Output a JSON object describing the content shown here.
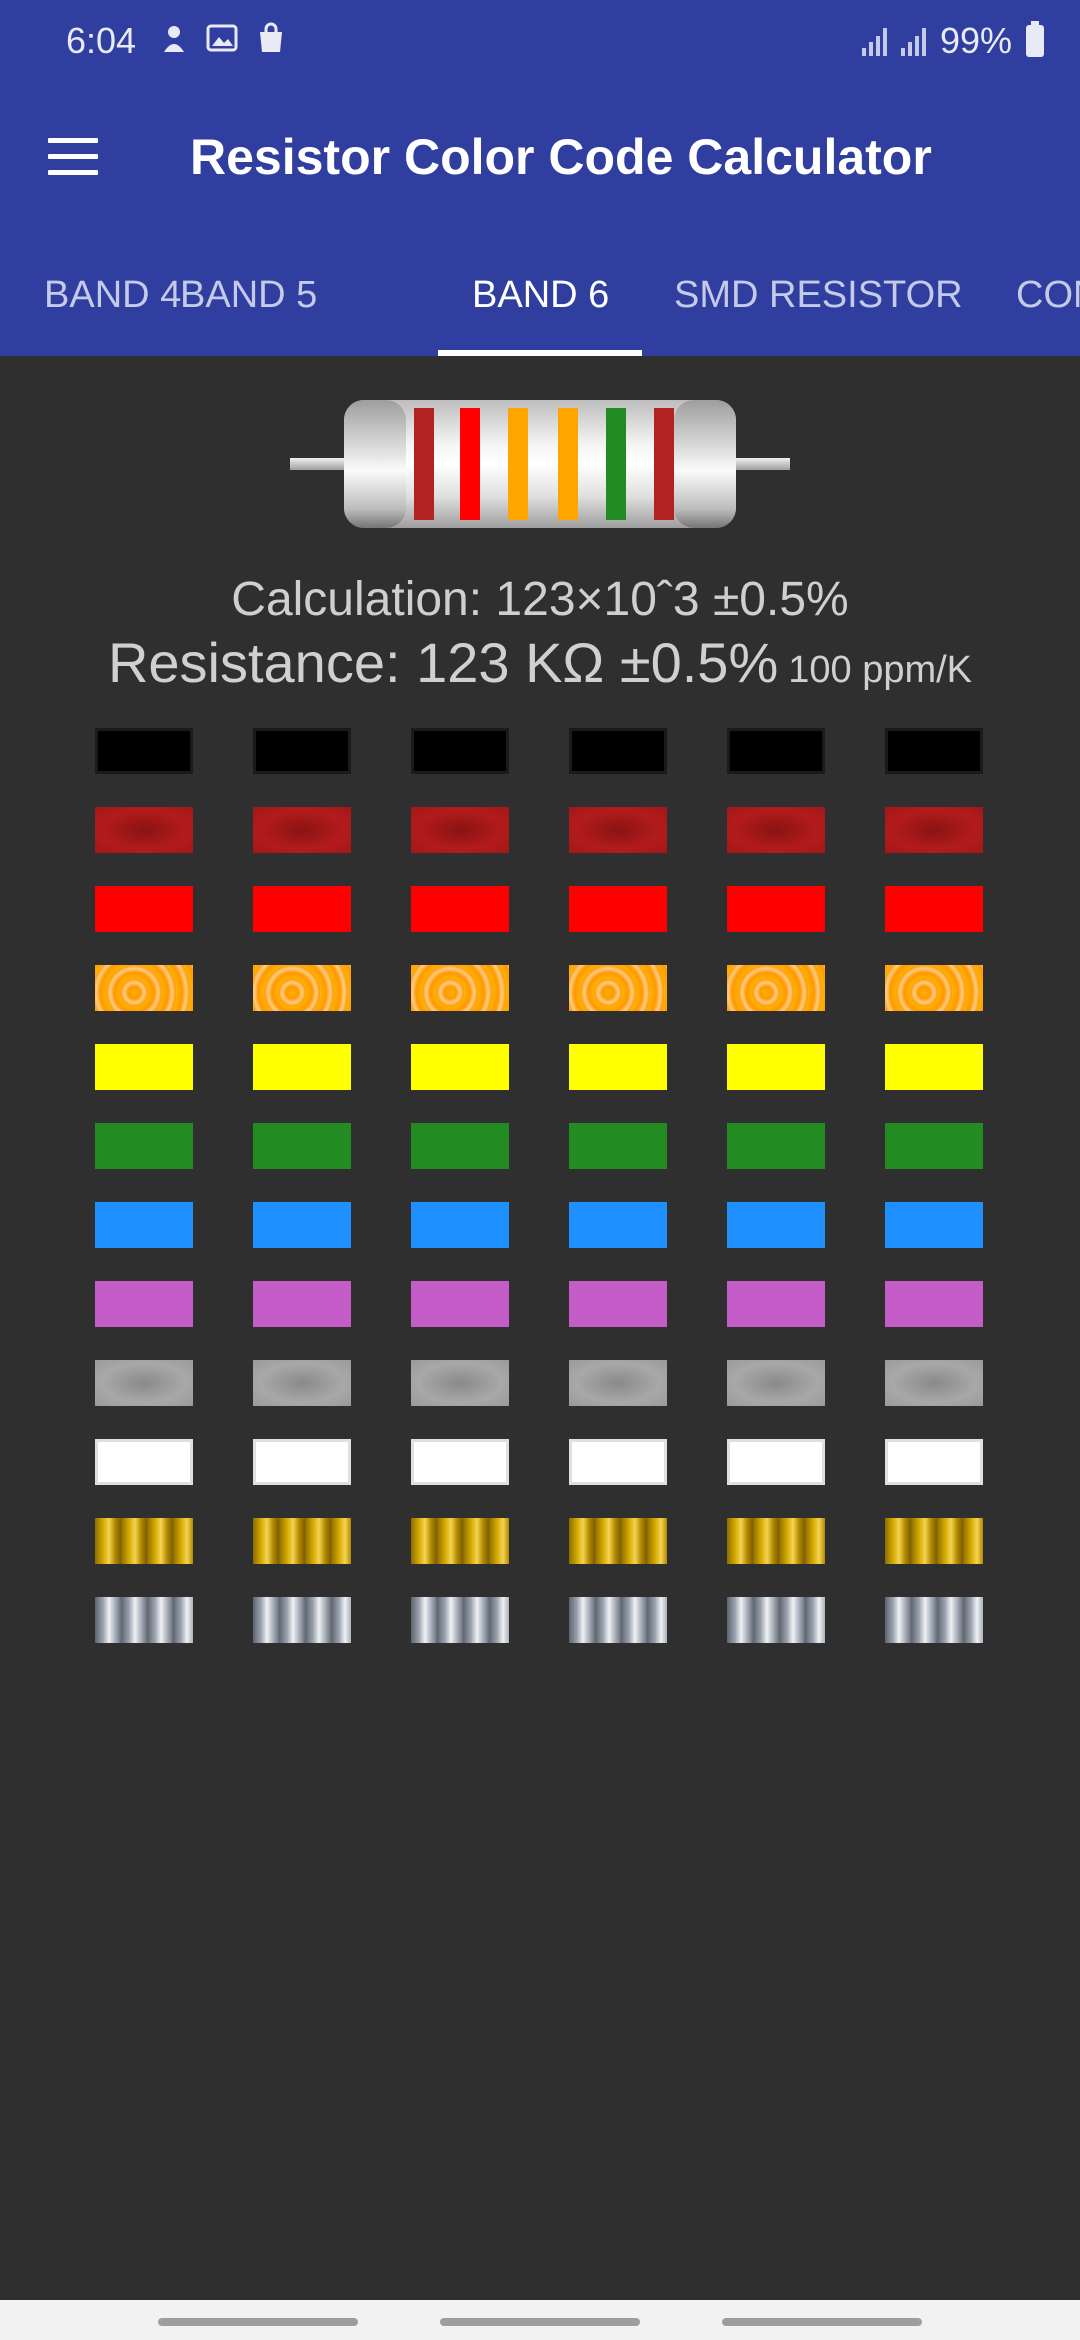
{
  "status_bar": {
    "time": "6:04",
    "battery": "99%",
    "icons": [
      "notification-icon",
      "image-icon",
      "shopping-bag-icon",
      "signal-icon",
      "signal-icon",
      "battery-icon"
    ]
  },
  "app_bar": {
    "title": "Resistor Color Code Calculator",
    "menu_icon": "hamburger-menu-icon"
  },
  "tabs": [
    {
      "label": "BAND 4",
      "active": false
    },
    {
      "label": "BAND 5",
      "active": false
    },
    {
      "label": "BAND 6",
      "active": true
    },
    {
      "label": "SMD RESISTOR",
      "active": false
    },
    {
      "label": "CON",
      "active": false
    }
  ],
  "resistor": {
    "band_colors": [
      "#b22222",
      "#ff0000",
      "#ffa500",
      "#ffa500",
      "#228b22",
      "#b22222"
    ]
  },
  "result": {
    "calculation": "Calculation: 123×10ˆ3 ±0.5%",
    "resistance": "Resistance: 123 KΩ ±0.5%",
    "tempco": "100 ppm/K"
  },
  "color_grid": {
    "columns": 6,
    "rows": [
      "black",
      "brown",
      "red",
      "orange",
      "yellow",
      "green",
      "blue",
      "violet",
      "gray",
      "white",
      "gold",
      "silver"
    ],
    "colors": {
      "black": "#000000",
      "brown": "#a31717",
      "red": "#ff0000",
      "orange": "#ffa000",
      "yellow": "#ffff00",
      "green": "#228b22",
      "blue": "#1e90ff",
      "violet": "#c45cc8",
      "gray": "#9a9a9a",
      "white": "#ffffff",
      "gold": "#c9a000",
      "silver": "#aab1ba"
    }
  },
  "theme": {
    "primary": "#303f9f",
    "background": "#2f2f2f"
  }
}
